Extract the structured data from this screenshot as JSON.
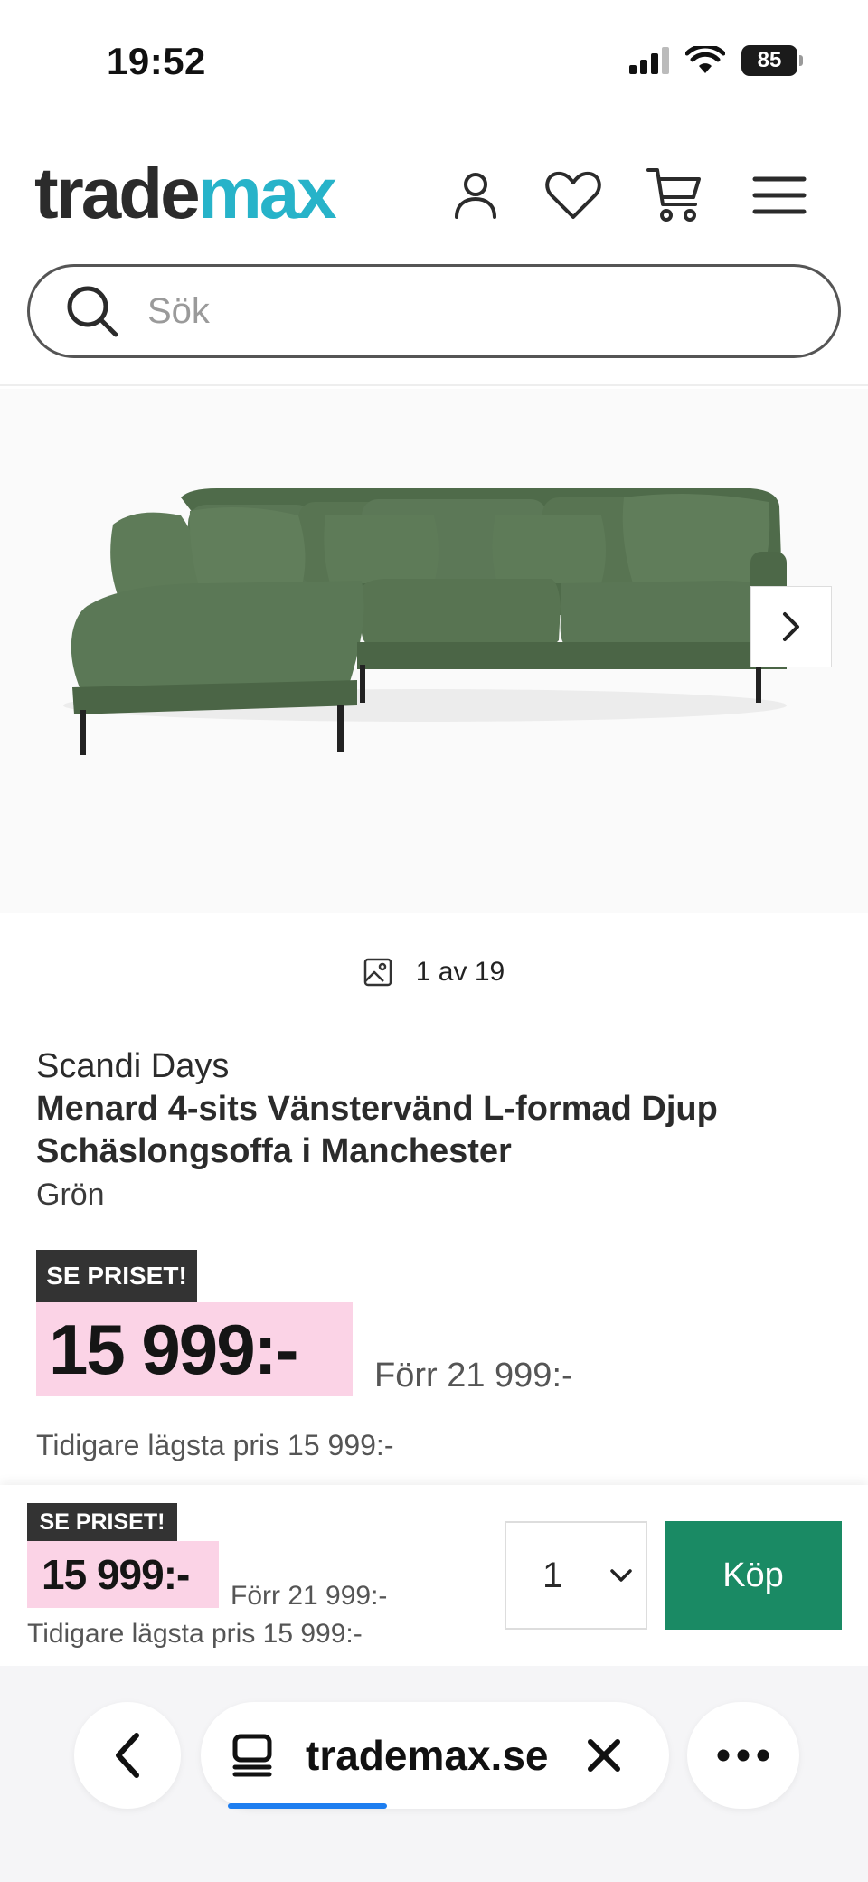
{
  "status_bar": {
    "time": "19:52",
    "battery": "85"
  },
  "header": {
    "logo_part1": "trade",
    "logo_part2": "max",
    "logo_accent_color": "#27b3c9"
  },
  "search": {
    "placeholder": "Sök"
  },
  "gallery": {
    "counter": "1 av 19"
  },
  "product": {
    "brand": "Scandi Days",
    "title": "Menard 4-sits Vänstervänd L-formad Djup Schäslongsoffa i Manchester",
    "color": "Grön",
    "badge": "SE PRISET!",
    "price": "15 999:-",
    "old_price": "Förr 21 999:-",
    "lowest_price": "Tidigare lägsta pris 15 999:-",
    "price_bg_color": "#fbd3e6"
  },
  "sticky": {
    "badge": "SE PRISET!",
    "price": "15 999:-",
    "old_price": "Förr 21 999:-",
    "lowest_price": "Tidigare lägsta pris 15 999:-",
    "quantity": "1",
    "buy_label": "Köp",
    "buy_color": "#1a8a64"
  },
  "browser": {
    "url": "trademax.se"
  }
}
